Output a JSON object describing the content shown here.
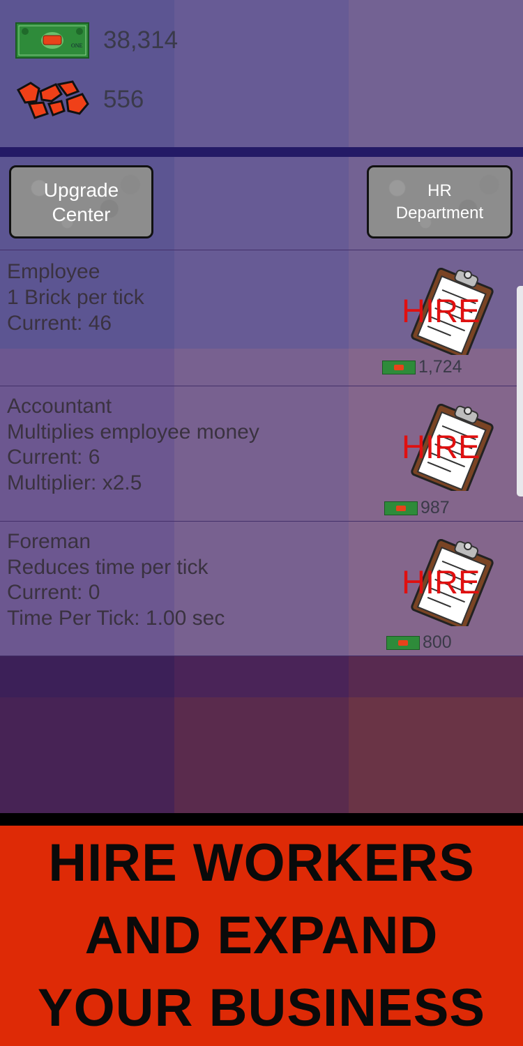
{
  "currency": {
    "money": "38,314",
    "bricks": "556"
  },
  "buttons": {
    "upgrade_line1": "Upgrade",
    "upgrade_line2": "Center",
    "hr_line1": "HR",
    "hr_line2": "Department"
  },
  "jobs": [
    {
      "title": "Employee",
      "desc": "1 Brick per tick",
      "current": "Current: 46",
      "extra": "",
      "hire": "HIRE",
      "cost": "1,724"
    },
    {
      "title": "Accountant",
      "desc": "Multiplies employee money",
      "current": "Current: 6",
      "extra": "Multiplier: x2.5",
      "hire": "HIRE",
      "cost": "987"
    },
    {
      "title": "Foreman",
      "desc": "Reduces time per tick",
      "current": "Current: 0",
      "extra": "Time Per Tick: 1.00 sec",
      "hire": "HIRE",
      "cost": "800"
    }
  ],
  "banner": {
    "line1": "HIRE WORKERS",
    "line2": "AND EXPAND",
    "line3": "YOUR BUSINESS"
  },
  "colors": {
    "hire_red": "#e01010",
    "banner_red": "#de2a06",
    "panel_purple": "#6a5a96"
  },
  "icons": [
    "dollar-bill-icon",
    "bricks-icon",
    "clipboard-icon"
  ]
}
